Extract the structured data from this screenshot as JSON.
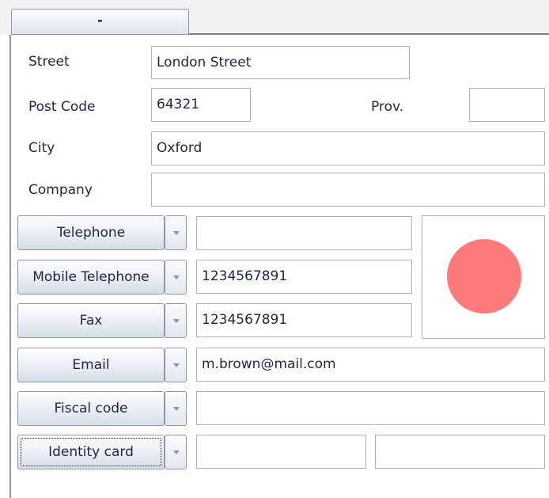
{
  "tab": {
    "label": "-"
  },
  "address": {
    "street_label": "Street",
    "street_value": "London Street",
    "postcode_label": "Post Code",
    "postcode_value": "64321",
    "prov_label": "Prov.",
    "prov_value": "",
    "city_label": "City",
    "city_value": "Oxford",
    "company_label": "Company",
    "company_value": ""
  },
  "contacts": [
    {
      "label": "Telephone",
      "value": ""
    },
    {
      "label": "Mobile Telephone",
      "value": "1234567891"
    },
    {
      "label": "Fax",
      "value": "1234567891"
    },
    {
      "label": "Email",
      "value": "m.brown@mail.com"
    },
    {
      "label": "Fiscal code",
      "value": ""
    },
    {
      "label": "Identity card",
      "value": "",
      "value2": ""
    }
  ],
  "status_indicator": {
    "color": "#ff7b7b"
  }
}
